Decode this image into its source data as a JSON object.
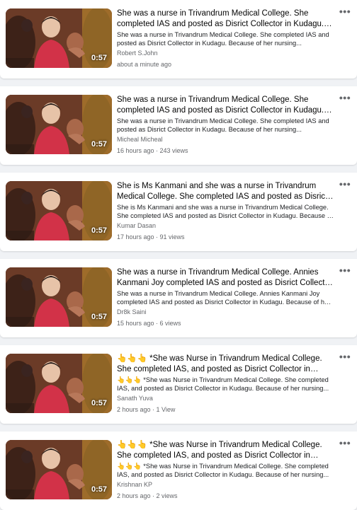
{
  "posts": [
    {
      "title": "She was a nurse in Trivandrum Medical College. She completed IAS and posted as Disrict Collector in Kudagu. Because of her nursing...",
      "description": "She was a nurse in Trivandrum Medical College. She completed IAS and posted as Disrict Collector in Kudagu. Because of her nursing...",
      "author": "Robert S.John",
      "meta": "about a minute ago",
      "duration": "0:57"
    },
    {
      "title": "She was a nurse in Trivandrum Medical College. She completed IAS and posted as Disrict Collector in Kudagu. Because of her nursing...",
      "description": "She was a nurse in Trivandrum Medical College. She completed IAS and posted as Disrict Collector in Kudagu. Because of her nursing...",
      "author": "Micheal Micheal",
      "meta": "16 hours ago · 243 views",
      "duration": "0:57"
    },
    {
      "title": "She is Ms Kanmani and she was a nurse in Trivandrum Medical College. She completed IAS and posted as Disrict Collector in Kudagu.",
      "description": "She is Ms Kanmani and she was a nurse in Trivandrum Medical College. She completed IAS and posted as Disrict Collector in Kudagu. Because of her nursing...",
      "author": "Kumar Dasan",
      "meta": "17 hours ago · 91 views",
      "duration": "0:57"
    },
    {
      "title": "She was a nurse in Trivandrum Medical College. Annies Kanmani Joy completed IAS and posted as Disrict Collector in Kudagu.",
      "description": "She was a nurse in Trivandrum Medical College. Annies Kanmani Joy completed IAS and posted as Disrict Collector in Kudagu. Because of her nursing...",
      "author": "Dr8k Saini",
      "meta": "15 hours ago · 6 views",
      "duration": "0:57"
    },
    {
      "title": "👆👆👆 *She was Nurse in Trivandrum Medical College. She completed IAS, and posted as Disrict Collector in Kudagu. Because of her nursing...",
      "description": "👆👆👆 *She was Nurse in Trivandrum Medical College. She completed IAS, and posted as Disrict Collector in Kudagu. Because of her nursing...",
      "author": "Sanath Yuva",
      "meta": "2 hours ago · 1 View",
      "duration": "0:57"
    },
    {
      "title": "👆👆👆 *She was Nurse in Trivandrum Medical College. She completed IAS, and posted as Disrict Collector in Kudagu. Because of her nursing...",
      "description": "👆👆👆 *She was Nurse in Trivandrum Medical College. She completed IAS, and posted as Disrict Collector in Kudagu. Because of her nursing...",
      "author": "Krishnan KP",
      "meta": "2 hours ago · 2 views",
      "duration": "0:57"
    }
  ],
  "more_icon": "more-horizontal-icon",
  "colors": {
    "page_bg": "#f0f2f5",
    "card_bg": "#ffffff",
    "primary_text": "#050505",
    "secondary_text": "#65676b"
  }
}
